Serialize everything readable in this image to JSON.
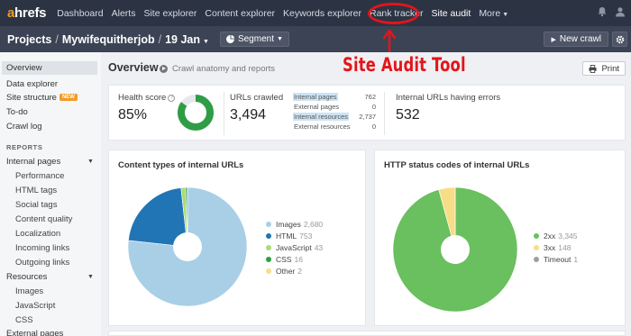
{
  "app": {
    "logo": "ahrefs"
  },
  "nav": [
    {
      "label": "Dashboard"
    },
    {
      "label": "Alerts"
    },
    {
      "label": "Site explorer"
    },
    {
      "label": "Content explorer"
    },
    {
      "label": "Keywords explorer"
    },
    {
      "label": "Rank tracker"
    },
    {
      "label": "Site audit"
    },
    {
      "label": "More"
    }
  ],
  "project": {
    "root": "Projects",
    "name": "Mywifequitherjob",
    "date": "19 Jan",
    "segment": "Segment",
    "new_crawl": "New crawl"
  },
  "sidebar": {
    "overview": "Overview",
    "data_explorer": "Data explorer",
    "site_structure": "Site structure",
    "new_badge": "NEW",
    "todo": "To-do",
    "crawl_log": "Crawl log",
    "reports_head": "REPORTS",
    "internal_pages": "Internal pages",
    "internal_sub": [
      "Performance",
      "HTML tags",
      "Social tags",
      "Content quality",
      "Localization",
      "Incoming links",
      "Outgoing links"
    ],
    "resources": "Resources",
    "resources_sub": [
      "Images",
      "JavaScript",
      "CSS"
    ],
    "external_pages": "External pages"
  },
  "overview": {
    "title": "Overview",
    "subtitle": "Crawl anatomy and reports",
    "print": "Print"
  },
  "annotation": {
    "text": "Site Audit Tool"
  },
  "stats": {
    "health_label": "Health score",
    "health_value": "85%",
    "health_pct": 85,
    "crawled_label": "URLs crawled",
    "crawled_value": "3,494",
    "breakdown": [
      {
        "label": "Internal pages",
        "value": "762"
      },
      {
        "label": "External pages",
        "value": "0"
      },
      {
        "label": "Internal resources",
        "value": "2,737"
      },
      {
        "label": "External resources",
        "value": "0"
      }
    ],
    "errors_label": "Internal URLs having errors",
    "errors_value": "532"
  },
  "chart_data": [
    {
      "type": "pie",
      "title": "Content types of internal URLs",
      "categories": [
        "Images",
        "HTML",
        "JavaScript",
        "CSS",
        "Other"
      ],
      "values": [
        2680,
        753,
        43,
        16,
        2
      ],
      "colors": [
        "#a9cfe6",
        "#2175b5",
        "#a8dc7a",
        "#2e9d45",
        "#f7dd86"
      ]
    },
    {
      "type": "pie",
      "title": "HTTP status codes of internal URLs",
      "categories": [
        "2xx",
        "3xx",
        "Timeout"
      ],
      "values": [
        3345,
        148,
        1
      ],
      "colors": [
        "#6abf5e",
        "#f7dd86",
        "#9e9e9e"
      ]
    }
  ],
  "legend_values": {
    "content": [
      "2,680",
      "753",
      "43",
      "16",
      "2"
    ],
    "status": [
      "3,345",
      "148",
      "1"
    ]
  },
  "colors": {
    "nav_bg": "#2c3444",
    "project_bar_bg": "#3b4354",
    "accent": "#f59a23",
    "annotation": "#e3151a",
    "health": "#2e9d45"
  }
}
